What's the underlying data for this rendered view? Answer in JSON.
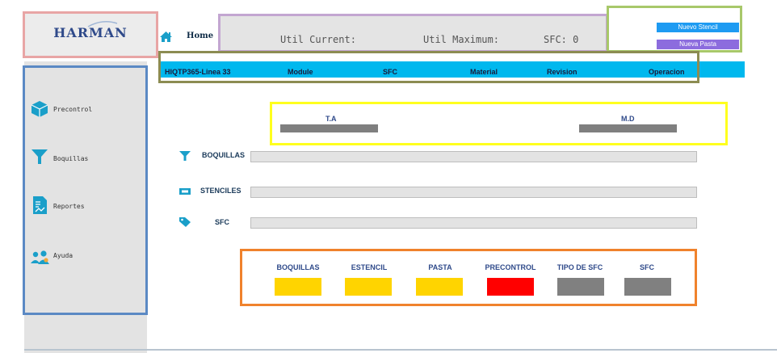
{
  "brand": {
    "logo": "HARMAN"
  },
  "header": {
    "home_label": "Home",
    "util_current_label": "Util Current:",
    "util_maximum_label": "Util Maximum:",
    "sfc_label": "SFC: 0"
  },
  "buttons": {
    "nuevo_stencil": "Nuevo Stencil",
    "nueva_pasta": "Nueva Pasta"
  },
  "columns": [
    "HIQTP365-Linea 33",
    "Module",
    "SFC",
    "Material",
    "Revision",
    "Operacion"
  ],
  "sidebar": {
    "items": [
      {
        "label": "Precontrol",
        "icon": "cube-icon"
      },
      {
        "label": "Boquillas",
        "icon": "funnel-icon"
      },
      {
        "label": "Reportes",
        "icon": "report-icon"
      },
      {
        "label": "Ayuda",
        "icon": "people-icon"
      }
    ]
  },
  "meters": {
    "ta_label": "T.A",
    "md_label": "M.D"
  },
  "fields": [
    {
      "label": "BOQUILLAS",
      "icon": "funnel-icon"
    },
    {
      "label": "STENCILES",
      "icon": "stencil-icon"
    },
    {
      "label": "SFC",
      "icon": "tag-icon"
    }
  ],
  "status": [
    {
      "label": "BOQUILLAS",
      "color": "#ffd400"
    },
    {
      "label": "ESTENCIL",
      "color": "#ffd400"
    },
    {
      "label": "PASTA",
      "color": "#ffd400"
    },
    {
      "label": "PRECONTROL",
      "color": "#ff0000"
    },
    {
      "label": "TIPO DE SFC",
      "color": "#808080"
    },
    {
      "label": "SFC",
      "color": "#808080"
    }
  ],
  "colors": {
    "accent_blue": "#00b8ee",
    "icon_teal": "#1a9fc9",
    "nuevo_stencil_bg": "#1e9bf2",
    "nueva_pasta_bg": "#8c6cde"
  }
}
